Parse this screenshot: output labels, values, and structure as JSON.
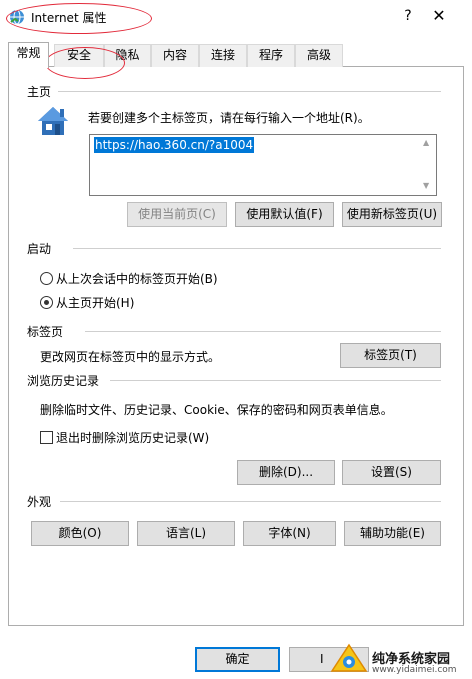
{
  "window": {
    "title": "Internet 属性",
    "help_glyph": "?",
    "close_glyph": "✕"
  },
  "tabs": [
    {
      "label": "常规"
    },
    {
      "label": "安全"
    },
    {
      "label": "隐私"
    },
    {
      "label": "内容"
    },
    {
      "label": "连接"
    },
    {
      "label": "程序"
    },
    {
      "label": "高级"
    }
  ],
  "home": {
    "header": "主页",
    "description": "若要创建多个主标签页，请在每行输入一个地址(R)。",
    "url": "https://hao.360.cn/?a1004",
    "use_current": "使用当前页(C)",
    "use_default": "使用默认值(F)",
    "use_new_tab": "使用新标签页(U)"
  },
  "startup": {
    "header": "启动",
    "option1": "从上次会话中的标签页开始(B)",
    "option2": "从主页开始(H)",
    "selected": "option2"
  },
  "tabs_section": {
    "header": "标签页",
    "description": "更改网页在标签页中的显示方式。",
    "button": "标签页(T)"
  },
  "history": {
    "header": "浏览历史记录",
    "description": "删除临时文件、历史记录、Cookie、保存的密码和网页表单信息。",
    "checkbox_label": "退出时删除浏览历史记录(W)",
    "checked": false,
    "delete": "删除(D)...",
    "settings": "设置(S)"
  },
  "appearance": {
    "header": "外观",
    "colors": "颜色(O)",
    "languages": "语言(L)",
    "fonts": "字体(N)",
    "accessibility": "辅助功能(E)"
  },
  "footer": {
    "ok": "确定",
    "cancel_partial": "I"
  },
  "watermark": {
    "text": "纯净系统家园",
    "url": "www.yidaimei.com"
  },
  "colors": {
    "accent": "#0078d7",
    "annotation": "#e22b3b",
    "button_face": "#e1e1e1"
  }
}
